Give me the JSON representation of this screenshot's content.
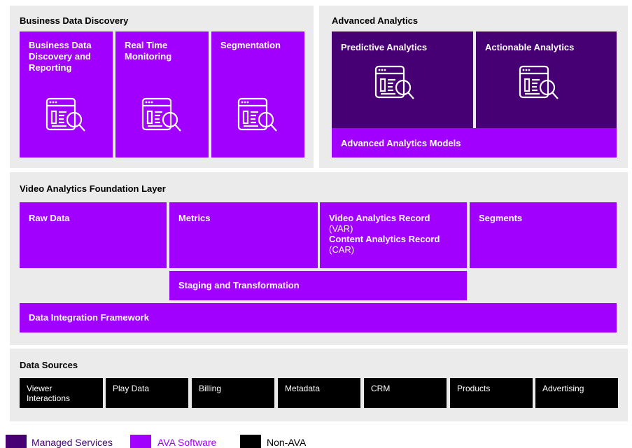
{
  "panels": {
    "bdd_title": "Business Data Discovery",
    "aa_title": "Advanced Analytics",
    "vafl_title": "Video Analytics Foundation Layer",
    "ds_title": "Data Sources"
  },
  "bdd_boxes": {
    "b1": "Business Data Discovery and Reporting",
    "b2": "Real Time Monitoring",
    "b3": "Segmentation"
  },
  "aa_boxes": {
    "predictive": "Predictive Analytics",
    "actionable": "Actionable Analytics",
    "models": "Advanced Analytics Models"
  },
  "foundation": {
    "raw_data": "Raw Data",
    "metrics": "Metrics",
    "var_title": "Video Analytics Record",
    "var_sub": "(VAR)",
    "car_title": "Content Analytics Record",
    "car_sub": "(CAR)",
    "segments": "Segments",
    "staging": "Staging and Transformation",
    "integration": "Data Integration Framework"
  },
  "sources": {
    "viewer_line1": "Viewer",
    "viewer_line2": "Interactions",
    "play": "Play Data",
    "billing": "Billing",
    "metadata": "Metadata",
    "crm": "CRM",
    "products": "Products",
    "advertising": "Advertising"
  },
  "legend": {
    "managed": "Managed Services",
    "ava": "AVA Software",
    "non_ava": "Non-AVA"
  },
  "colors": {
    "ava_software": "#a100ff",
    "managed_services": "#460073",
    "non_ava": "#000000",
    "panel_bg": "#ebebeb"
  }
}
